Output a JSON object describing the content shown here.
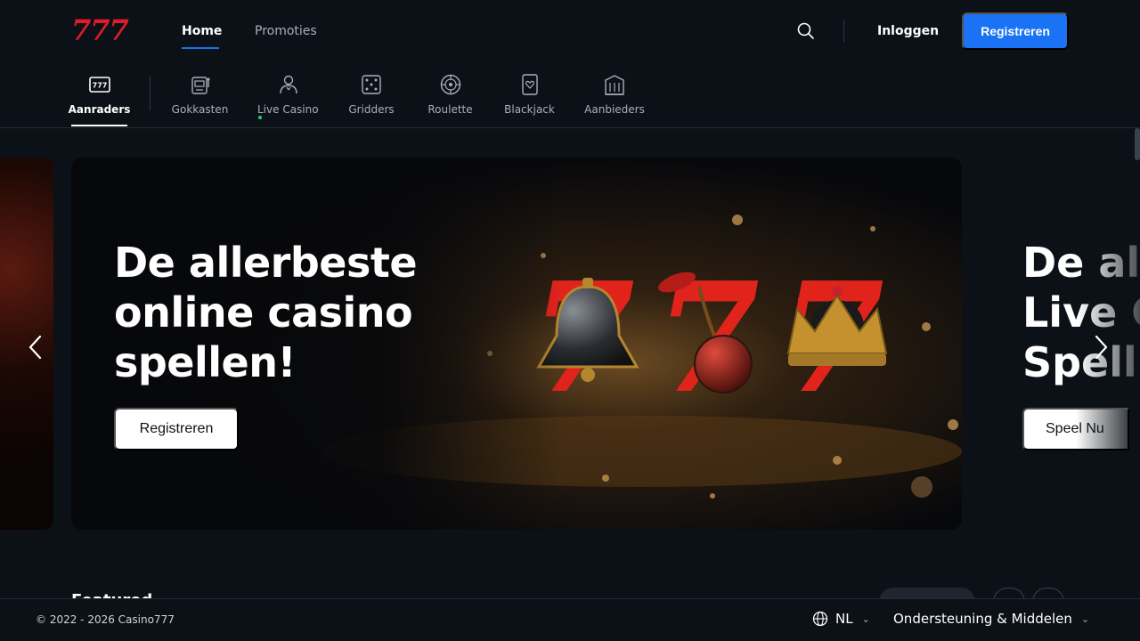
{
  "header": {
    "logo": "777",
    "nav": [
      {
        "label": "Home",
        "active": true
      },
      {
        "label": "Promoties",
        "active": false
      }
    ],
    "login_label": "Inloggen",
    "register_label": "Registreren"
  },
  "categories": [
    {
      "label": "Aanraders",
      "icon": "recommended-777-icon",
      "active": true
    },
    {
      "label": "Gokkasten",
      "icon": "slot-machine-icon"
    },
    {
      "label": "Live Casino",
      "icon": "live-dealer-icon",
      "live_indicator": true
    },
    {
      "label": "Gridders",
      "icon": "dice-icon"
    },
    {
      "label": "Roulette",
      "icon": "roulette-icon"
    },
    {
      "label": "Blackjack",
      "icon": "playing-card-icon"
    },
    {
      "label": "Aanbieders",
      "icon": "building-icon"
    }
  ],
  "carousel": {
    "main": {
      "title_lines": [
        "De allerbeste",
        "online casino",
        "spellen!"
      ],
      "cta": "Registreren"
    },
    "next": {
      "title_lines": [
        "De al",
        "Live C",
        "Spell"
      ],
      "cta": "Speel Nu"
    }
  },
  "section_peek": "Featured",
  "footer": {
    "copyright": "© 2022 - 2026 Casino777",
    "language": "NL",
    "support": "Ondersteuning & Middelen"
  },
  "colors": {
    "background": "#0c1117",
    "accent": "#1a73f5",
    "brand_red": "#e01c2a"
  }
}
